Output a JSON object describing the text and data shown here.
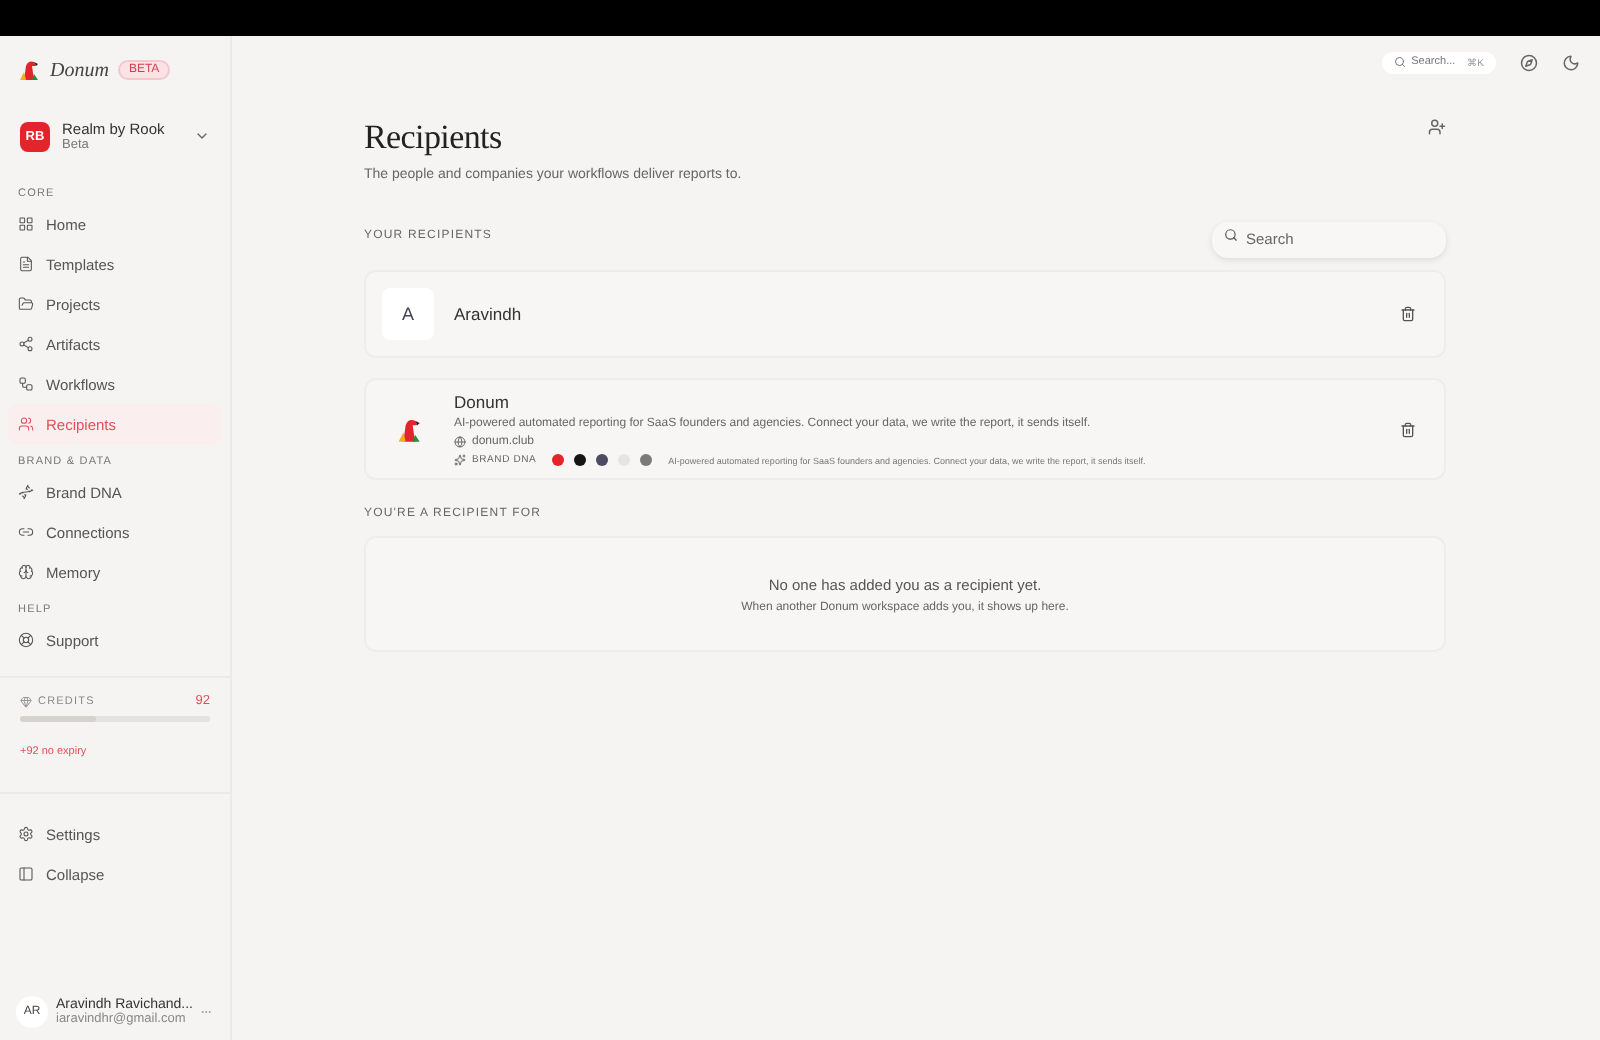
{
  "brand": {
    "name": "Donum",
    "badge": "BETA"
  },
  "workspace": {
    "initials": "RB",
    "name": "Realm by Rook",
    "plan": "Beta"
  },
  "nav_sections": [
    {
      "title": "CORE",
      "items": [
        {
          "label": "Home",
          "selected": false
        },
        {
          "label": "Templates",
          "selected": false
        },
        {
          "label": "Projects",
          "selected": false
        },
        {
          "label": "Artifacts",
          "selected": false
        },
        {
          "label": "Workflows",
          "selected": false
        },
        {
          "label": "Recipients",
          "selected": true
        }
      ]
    },
    {
      "title": "BRAND & DATA",
      "items": [
        {
          "label": "Brand DNA",
          "selected": false
        },
        {
          "label": "Connections",
          "selected": false
        },
        {
          "label": "Memory",
          "selected": false
        }
      ]
    },
    {
      "title": "HELP",
      "items": [
        {
          "label": "Support",
          "selected": false
        }
      ]
    }
  ],
  "credits": {
    "label": "CREDITS",
    "count": "92",
    "level": 0.4,
    "note": "+92 no expiry"
  },
  "bottom_nav": [
    {
      "label": "Settings"
    },
    {
      "label": "Collapse"
    }
  ],
  "user": {
    "initials": "AR",
    "name": "Aravindh Ravichand...",
    "email": "iaravindhr@gmail.com"
  },
  "topbar": {
    "search_placeholder": "Search...",
    "shortcut": "⌘K"
  },
  "page": {
    "title": "Recipients",
    "subtitle": "The people and companies your workflows deliver reports to."
  },
  "your_recipients": {
    "heading": "YOUR RECIPIENTS",
    "search_placeholder": "Search",
    "items": [
      {
        "kind": "person",
        "avatar": "A",
        "name": "Aravindh"
      },
      {
        "kind": "company",
        "name": "Donum",
        "description": "AI-powered automated reporting for SaaS founders and agencies. Connect your data, we write the report, it sends itself.",
        "website": "donum.club",
        "dna_label": "BRAND DNA",
        "dna_colors": [
          {
            "color": "#e3242b"
          },
          {
            "color": "#151515"
          },
          {
            "color": "#4b4b63"
          },
          {
            "color": "#e6e4e1"
          },
          {
            "color": "#7a7a7a"
          }
        ],
        "dna_text": "AI-powered automated reporting for SaaS founders and agencies. Connect your data, we write the report, it sends itself."
      }
    ]
  },
  "recipient_for": {
    "heading": "YOU'RE A RECIPIENT FOR",
    "empty_title": "No one has added you as a recipient yet.",
    "empty_text": "When another Donum workspace adds you, it shows up here."
  }
}
